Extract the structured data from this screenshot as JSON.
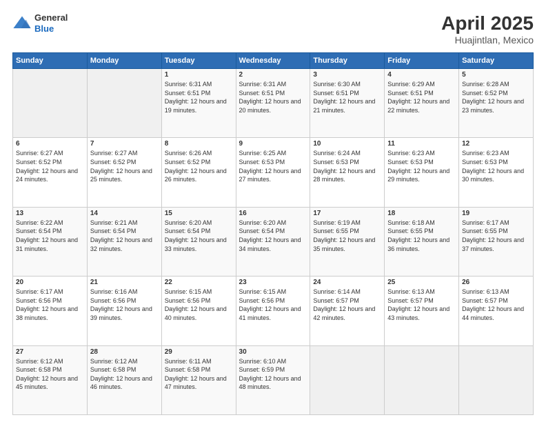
{
  "header": {
    "logo": {
      "general": "General",
      "blue": "Blue"
    },
    "title": "April 2025",
    "subtitle": "Huajintlan, Mexico"
  },
  "weekdays": [
    "Sunday",
    "Monday",
    "Tuesday",
    "Wednesday",
    "Thursday",
    "Friday",
    "Saturday"
  ],
  "weeks": [
    [
      {
        "day": "",
        "sunrise": "",
        "sunset": "",
        "daylight": ""
      },
      {
        "day": "",
        "sunrise": "",
        "sunset": "",
        "daylight": ""
      },
      {
        "day": "1",
        "sunrise": "Sunrise: 6:31 AM",
        "sunset": "Sunset: 6:51 PM",
        "daylight": "Daylight: 12 hours and 19 minutes."
      },
      {
        "day": "2",
        "sunrise": "Sunrise: 6:31 AM",
        "sunset": "Sunset: 6:51 PM",
        "daylight": "Daylight: 12 hours and 20 minutes."
      },
      {
        "day": "3",
        "sunrise": "Sunrise: 6:30 AM",
        "sunset": "Sunset: 6:51 PM",
        "daylight": "Daylight: 12 hours and 21 minutes."
      },
      {
        "day": "4",
        "sunrise": "Sunrise: 6:29 AM",
        "sunset": "Sunset: 6:51 PM",
        "daylight": "Daylight: 12 hours and 22 minutes."
      },
      {
        "day": "5",
        "sunrise": "Sunrise: 6:28 AM",
        "sunset": "Sunset: 6:52 PM",
        "daylight": "Daylight: 12 hours and 23 minutes."
      }
    ],
    [
      {
        "day": "6",
        "sunrise": "Sunrise: 6:27 AM",
        "sunset": "Sunset: 6:52 PM",
        "daylight": "Daylight: 12 hours and 24 minutes."
      },
      {
        "day": "7",
        "sunrise": "Sunrise: 6:27 AM",
        "sunset": "Sunset: 6:52 PM",
        "daylight": "Daylight: 12 hours and 25 minutes."
      },
      {
        "day": "8",
        "sunrise": "Sunrise: 6:26 AM",
        "sunset": "Sunset: 6:52 PM",
        "daylight": "Daylight: 12 hours and 26 minutes."
      },
      {
        "day": "9",
        "sunrise": "Sunrise: 6:25 AM",
        "sunset": "Sunset: 6:53 PM",
        "daylight": "Daylight: 12 hours and 27 minutes."
      },
      {
        "day": "10",
        "sunrise": "Sunrise: 6:24 AM",
        "sunset": "Sunset: 6:53 PM",
        "daylight": "Daylight: 12 hours and 28 minutes."
      },
      {
        "day": "11",
        "sunrise": "Sunrise: 6:23 AM",
        "sunset": "Sunset: 6:53 PM",
        "daylight": "Daylight: 12 hours and 29 minutes."
      },
      {
        "day": "12",
        "sunrise": "Sunrise: 6:23 AM",
        "sunset": "Sunset: 6:53 PM",
        "daylight": "Daylight: 12 hours and 30 minutes."
      }
    ],
    [
      {
        "day": "13",
        "sunrise": "Sunrise: 6:22 AM",
        "sunset": "Sunset: 6:54 PM",
        "daylight": "Daylight: 12 hours and 31 minutes."
      },
      {
        "day": "14",
        "sunrise": "Sunrise: 6:21 AM",
        "sunset": "Sunset: 6:54 PM",
        "daylight": "Daylight: 12 hours and 32 minutes."
      },
      {
        "day": "15",
        "sunrise": "Sunrise: 6:20 AM",
        "sunset": "Sunset: 6:54 PM",
        "daylight": "Daylight: 12 hours and 33 minutes."
      },
      {
        "day": "16",
        "sunrise": "Sunrise: 6:20 AM",
        "sunset": "Sunset: 6:54 PM",
        "daylight": "Daylight: 12 hours and 34 minutes."
      },
      {
        "day": "17",
        "sunrise": "Sunrise: 6:19 AM",
        "sunset": "Sunset: 6:55 PM",
        "daylight": "Daylight: 12 hours and 35 minutes."
      },
      {
        "day": "18",
        "sunrise": "Sunrise: 6:18 AM",
        "sunset": "Sunset: 6:55 PM",
        "daylight": "Daylight: 12 hours and 36 minutes."
      },
      {
        "day": "19",
        "sunrise": "Sunrise: 6:17 AM",
        "sunset": "Sunset: 6:55 PM",
        "daylight": "Daylight: 12 hours and 37 minutes."
      }
    ],
    [
      {
        "day": "20",
        "sunrise": "Sunrise: 6:17 AM",
        "sunset": "Sunset: 6:56 PM",
        "daylight": "Daylight: 12 hours and 38 minutes."
      },
      {
        "day": "21",
        "sunrise": "Sunrise: 6:16 AM",
        "sunset": "Sunset: 6:56 PM",
        "daylight": "Daylight: 12 hours and 39 minutes."
      },
      {
        "day": "22",
        "sunrise": "Sunrise: 6:15 AM",
        "sunset": "Sunset: 6:56 PM",
        "daylight": "Daylight: 12 hours and 40 minutes."
      },
      {
        "day": "23",
        "sunrise": "Sunrise: 6:15 AM",
        "sunset": "Sunset: 6:56 PM",
        "daylight": "Daylight: 12 hours and 41 minutes."
      },
      {
        "day": "24",
        "sunrise": "Sunrise: 6:14 AM",
        "sunset": "Sunset: 6:57 PM",
        "daylight": "Daylight: 12 hours and 42 minutes."
      },
      {
        "day": "25",
        "sunrise": "Sunrise: 6:13 AM",
        "sunset": "Sunset: 6:57 PM",
        "daylight": "Daylight: 12 hours and 43 minutes."
      },
      {
        "day": "26",
        "sunrise": "Sunrise: 6:13 AM",
        "sunset": "Sunset: 6:57 PM",
        "daylight": "Daylight: 12 hours and 44 minutes."
      }
    ],
    [
      {
        "day": "27",
        "sunrise": "Sunrise: 6:12 AM",
        "sunset": "Sunset: 6:58 PM",
        "daylight": "Daylight: 12 hours and 45 minutes."
      },
      {
        "day": "28",
        "sunrise": "Sunrise: 6:12 AM",
        "sunset": "Sunset: 6:58 PM",
        "daylight": "Daylight: 12 hours and 46 minutes."
      },
      {
        "day": "29",
        "sunrise": "Sunrise: 6:11 AM",
        "sunset": "Sunset: 6:58 PM",
        "daylight": "Daylight: 12 hours and 47 minutes."
      },
      {
        "day": "30",
        "sunrise": "Sunrise: 6:10 AM",
        "sunset": "Sunset: 6:59 PM",
        "daylight": "Daylight: 12 hours and 48 minutes."
      },
      {
        "day": "",
        "sunrise": "",
        "sunset": "",
        "daylight": ""
      },
      {
        "day": "",
        "sunrise": "",
        "sunset": "",
        "daylight": ""
      },
      {
        "day": "",
        "sunrise": "",
        "sunset": "",
        "daylight": ""
      }
    ]
  ]
}
